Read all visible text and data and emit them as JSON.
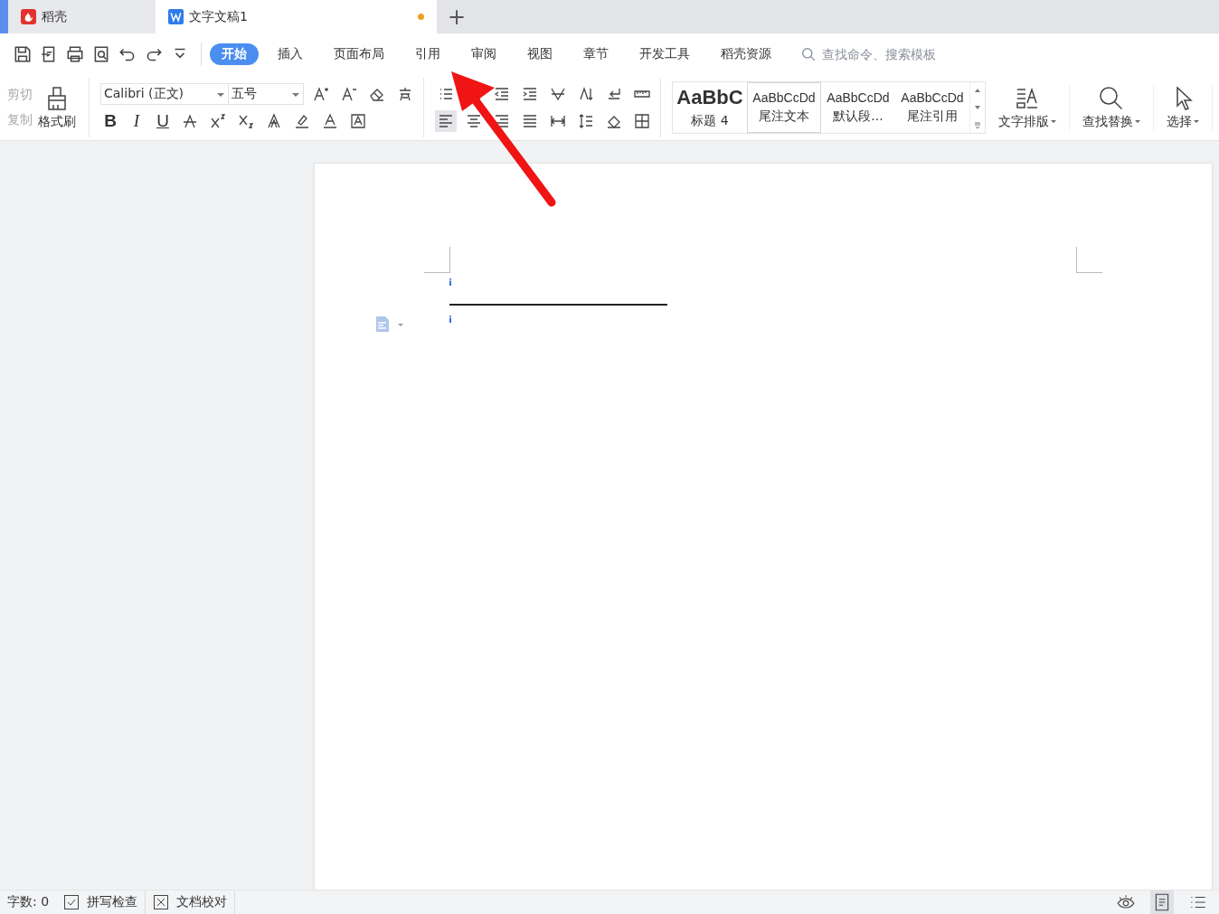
{
  "doc_tabs": [
    {
      "label": "稻壳",
      "kind": "docer",
      "selected": false,
      "modified": false
    },
    {
      "label": "文字文稿1",
      "kind": "writer",
      "selected": true,
      "modified": true
    }
  ],
  "new_tab": "+",
  "menu_tabs": [
    {
      "label": "开始",
      "selected": true
    },
    {
      "label": "插入",
      "selected": false
    },
    {
      "label": "页面布局",
      "selected": false
    },
    {
      "label": "引用",
      "selected": false
    },
    {
      "label": "审阅",
      "selected": false
    },
    {
      "label": "视图",
      "selected": false
    },
    {
      "label": "章节",
      "selected": false
    },
    {
      "label": "开发工具",
      "selected": false
    },
    {
      "label": "稻壳资源",
      "selected": false
    }
  ],
  "search": {
    "placeholder": "查找命令、搜索模板"
  },
  "clipboard": [
    {
      "label": "剪切",
      "disabled": true
    },
    {
      "label": "复制",
      "disabled": true
    }
  ],
  "format_painter": "格式刷",
  "font": {
    "family": "Calibri (正文)",
    "size": "五号"
  },
  "text_format": [
    "B",
    "I",
    "U"
  ],
  "styles": [
    {
      "preview": "AaBbC",
      "label": "标题 4",
      "kind": "heading",
      "selected": false
    },
    {
      "preview": "AaBbCcDd",
      "label": "尾注文本",
      "kind": "normal",
      "selected": true
    },
    {
      "preview": "AaBbCcDd",
      "label": "默认段...",
      "kind": "normal",
      "selected": false
    },
    {
      "preview": "AaBbCcDd",
      "label": "尾注引用",
      "kind": "normal",
      "selected": false
    }
  ],
  "big_buttons": [
    {
      "label": "文字排版",
      "kind": "layout"
    },
    {
      "label": "查找替换",
      "kind": "find"
    },
    {
      "label": "选择",
      "kind": "select"
    }
  ],
  "status_bar": {
    "word_count": "字数: 0",
    "buttons": [
      {
        "label": "拼写检查",
        "kind": "check"
      },
      {
        "label": "文档校对",
        "kind": "cross"
      }
    ]
  }
}
